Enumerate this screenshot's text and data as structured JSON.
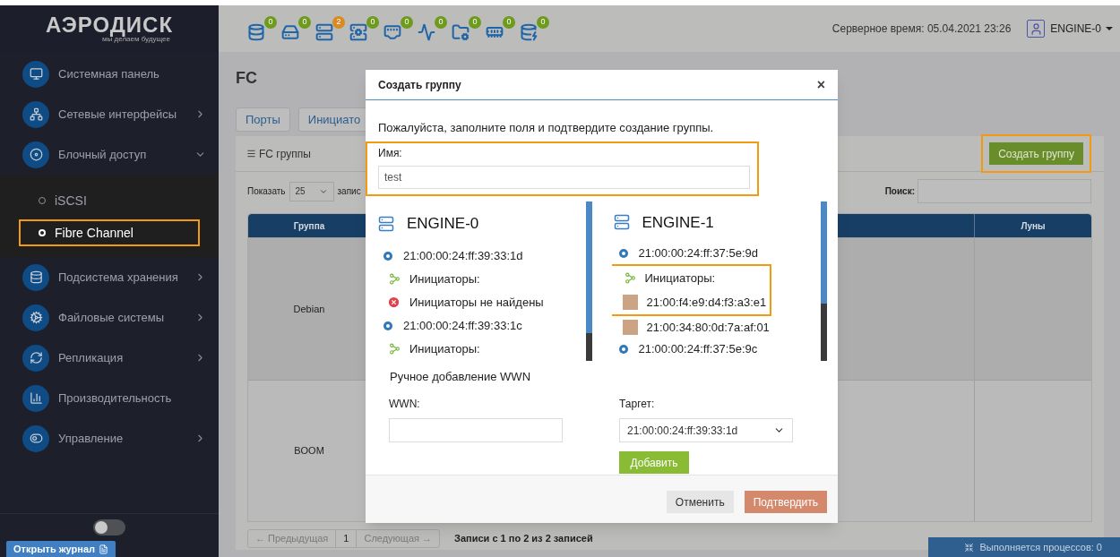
{
  "logo": {
    "name": "АЭРОДИСК",
    "tagline": "мы делаем будущее"
  },
  "toolbar": {
    "indicators": [
      {
        "count": "0",
        "color": "#6e9a1e"
      },
      {
        "count": "0",
        "color": "#6e9a1e"
      },
      {
        "count": "2",
        "color": "#d98a22"
      },
      {
        "count": "0",
        "color": "#6e9a1e"
      },
      {
        "count": "0",
        "color": "#6e9a1e"
      },
      {
        "count": "0",
        "color": "#6e9a1e"
      },
      {
        "count": "0",
        "color": "#6e9a1e"
      },
      {
        "count": "0",
        "color": "#6e9a1e"
      },
      {
        "count": "0",
        "color": "#6e9a1e"
      }
    ],
    "server_time": "Серверное время: 05.04.2021 23:26",
    "user": "ENGINE-0"
  },
  "sidebar": {
    "items": [
      {
        "label": "Системная панель",
        "kind": "link"
      },
      {
        "label": "Сетевые интерфейсы",
        "kind": "group",
        "expanded": false
      },
      {
        "label": "Блочный доступ",
        "kind": "group",
        "expanded": true,
        "children": [
          {
            "label": "iSCSI",
            "selected": false,
            "highlighted": false
          },
          {
            "label": "Fibre Channel",
            "selected": true,
            "highlighted": true
          }
        ]
      },
      {
        "label": "Подсистема хранения",
        "kind": "group",
        "expanded": false
      },
      {
        "label": "Файловые системы",
        "kind": "group",
        "expanded": false
      },
      {
        "label": "Репликация",
        "kind": "group",
        "expanded": false
      },
      {
        "label": "Производительность",
        "kind": "link"
      },
      {
        "label": "Управление",
        "kind": "group",
        "expanded": false
      }
    ],
    "dark_mode": false,
    "journal_button": "Открыть журнал"
  },
  "page": {
    "title": "FC",
    "tabs": [
      {
        "label": "Порты",
        "selected": false
      },
      {
        "label": "Инициато",
        "selected": false
      }
    ],
    "panel_title": "FC группы",
    "create_button": "Создать группу",
    "create_highlighted": true,
    "show_label": "Показать",
    "page_size": "25",
    "entries_label": "запис",
    "search_label": "Поиск:",
    "table": {
      "columns": [
        "Группа",
        "",
        "Луны"
      ],
      "rows": [
        [
          "Debian"
        ],
        [
          "BOOM"
        ]
      ]
    },
    "pagination": {
      "previous": "← Предыдущая",
      "page": "1",
      "next": "Следующая →",
      "info": "Записи с 1 по 2 из 2 записей"
    }
  },
  "status_bar": "Выполняется процессов: 0",
  "dialog": {
    "title": "Создать группу",
    "close": "×",
    "prompt": "Пожалуйста, заполните поля и подтвердите создание группы.",
    "name_label": "Имя:",
    "name_value": "test",
    "name_highlighted": true,
    "engines": [
      {
        "name": "ENGINE-0",
        "items": [
          {
            "kind": "target",
            "text": "21:00:00:24:ff:39:33:1d"
          },
          {
            "kind": "heading",
            "text": "Инициаторы:"
          },
          {
            "kind": "none",
            "text": "Инициаторы не найдены"
          },
          {
            "kind": "target",
            "text": "21:00:00:24:ff:39:33:1c"
          },
          {
            "kind": "heading",
            "text": "Инициаторы:"
          }
        ]
      },
      {
        "name": "ENGINE-1",
        "items": [
          {
            "kind": "target",
            "text": "21:00:00:24:ff:37:5e:9d"
          },
          {
            "kind": "group",
            "highlighted": true,
            "children": [
              {
                "kind": "heading",
                "text": "Инициаторы:"
              },
              {
                "kind": "initiator",
                "text": "21:00:f4:e9:d4:f3:a3:e1"
              }
            ]
          },
          {
            "kind": "initiator",
            "text": "21:00:34:80:0d:7a:af:01"
          },
          {
            "kind": "target",
            "text": "21:00:00:24:ff:37:5e:9c"
          }
        ]
      }
    ],
    "manual_title": "Ручное добавление WWN",
    "wwn_label": "WWN:",
    "target_label": "Таргет:",
    "target_value": "21:00:00:24:ff:39:33:1d",
    "add_button": "Добавить",
    "cancel_button": "Отменить",
    "confirm_button": "Подтвердить"
  }
}
